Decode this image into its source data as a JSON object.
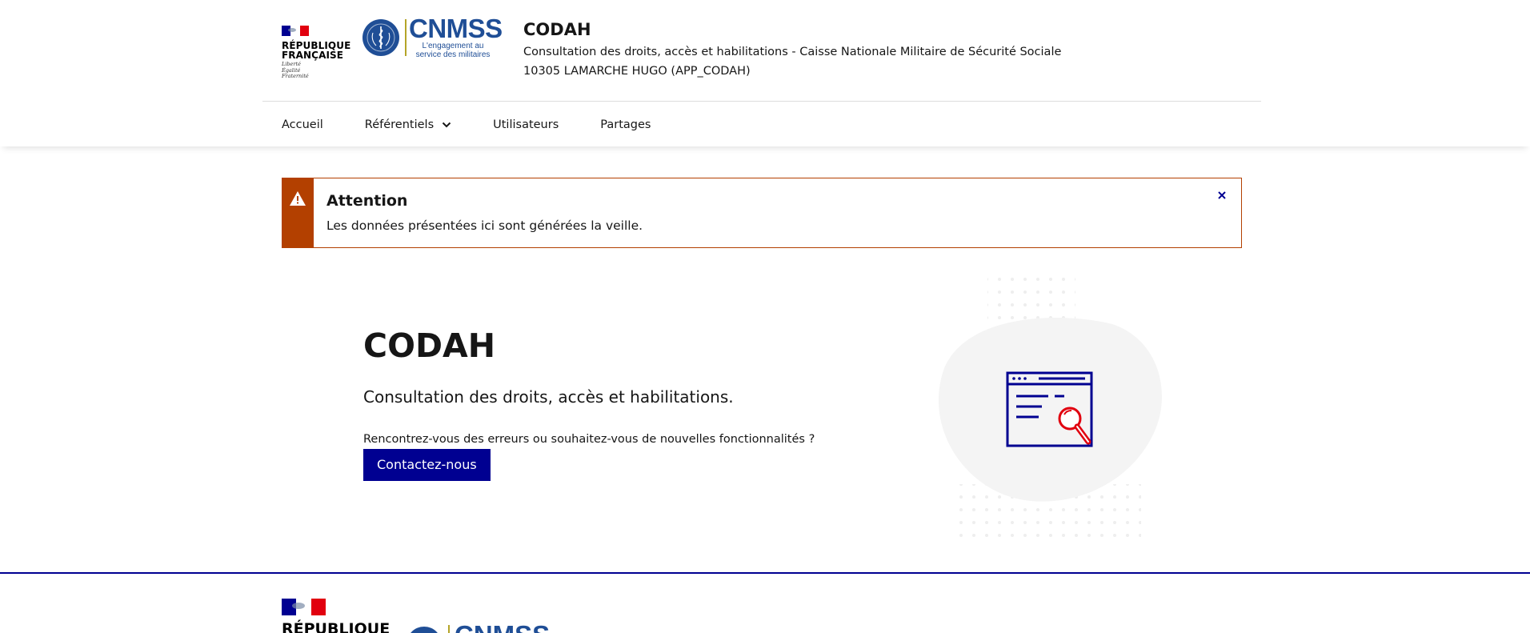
{
  "header": {
    "republic_name_line1": "RÉPUBLIQUE",
    "republic_name_line2": "FRANÇAISE",
    "motto_line1": "Liberté",
    "motto_line2": "Égalité",
    "motto_line3": "Fraternité",
    "partner_logo_title": "CNMSS",
    "partner_logo_tagline": "L'engagement au service des militaires",
    "service_title": "CODAH",
    "service_tagline": "Consultation des droits, accès et habilitations - Caisse Nationale Militaire de Sécurité Sociale",
    "user_info": "10305 LAMARCHE HUGO (APP_CODAH)"
  },
  "nav": {
    "items": [
      {
        "label": "Accueil"
      },
      {
        "label": "Référentiels",
        "icon": "chevron-down-icon"
      },
      {
        "label": "Utilisateurs"
      },
      {
        "label": "Partages"
      }
    ]
  },
  "alert": {
    "title": "Attention",
    "text": "Les données présentées ici sont générées la veille.",
    "icon": "warning-icon",
    "close_icon": "close-icon"
  },
  "hero": {
    "title": "CODAH",
    "lead": "Consultation des droits, accès et habilitations.",
    "question": "Rencontrez-vous des erreurs ou souhaitez-vous de nouvelles fonctionnalités ?",
    "button_label": "Contactez-nous",
    "illustration_icon": "document-search-icon"
  },
  "footer": {
    "republic_name_line1": "RÉPUBLIQUE",
    "partner_logo_title": "CNMSS"
  },
  "colors": {
    "primary_blue": "#000091",
    "alert_orange": "#b34000",
    "marianne_red": "#e1000f",
    "cnmss_blue": "#1f4e96",
    "cnmss_gold": "#b4a428",
    "text": "#161616"
  }
}
